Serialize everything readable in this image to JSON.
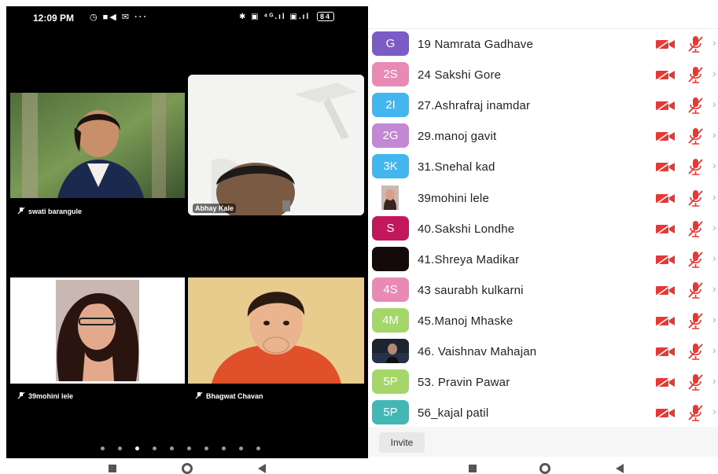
{
  "status_bar": {
    "time": "12:09 PM",
    "left_icons": "◷ ■◀ ✉ ···",
    "right_icons": "✱ ▣ ⁴ᴳ.ıl ▣.ıl",
    "battery": "84"
  },
  "video_tiles": [
    {
      "name": "swati barangule",
      "muted": true
    },
    {
      "name": "Abhay Kale",
      "muted": false
    },
    {
      "name": "39mohini lele",
      "muted": true
    },
    {
      "name": "Bhagwat Chavan",
      "muted": true
    }
  ],
  "pager": {
    "count": 10,
    "active_index": 2
  },
  "participants": [
    {
      "initials": "G",
      "name": "19 Namrata Gadhave",
      "color": "#7b5cc7",
      "photo": false
    },
    {
      "initials": "2S",
      "name": "24 Sakshi Gore",
      "color": "#e88ab5",
      "photo": false
    },
    {
      "initials": "2I",
      "name": "27.Ashrafraj inamdar",
      "color": "#43b6f0",
      "photo": false
    },
    {
      "initials": "2G",
      "name": "29.manoj gavit",
      "color": "#c387d4",
      "photo": false
    },
    {
      "initials": "3K",
      "name": "31.Snehal kad",
      "color": "#43b6f0",
      "photo": false
    },
    {
      "initials": "",
      "name": "39mohini lele",
      "color": "#ffffff",
      "photo": true
    },
    {
      "initials": "S",
      "name": "40.Sakshi Londhe",
      "color": "#c2185b",
      "photo": false
    },
    {
      "initials": "",
      "name": "41.Shreya Madikar",
      "color": "#150a0a",
      "photo": false
    },
    {
      "initials": "4S",
      "name": "43 saurabh kulkarni",
      "color": "#e88ab5",
      "photo": false
    },
    {
      "initials": "4M",
      "name": "45.Manoj Mhaske",
      "color": "#a4d66a",
      "photo": false
    },
    {
      "initials": "",
      "name": "46. Vaishnav Mahajan",
      "color": "#1b2430",
      "photo": true
    },
    {
      "initials": "5P",
      "name": "53. Pravin Pawar",
      "color": "#a4d66a",
      "photo": false
    },
    {
      "initials": "5P",
      "name": "56_kajal patil",
      "color": "#43b6b6",
      "photo": false
    }
  ],
  "invite_label": "Invite",
  "colors": {
    "muted_red": "#e53935",
    "chevron": "#aaaaaa"
  }
}
